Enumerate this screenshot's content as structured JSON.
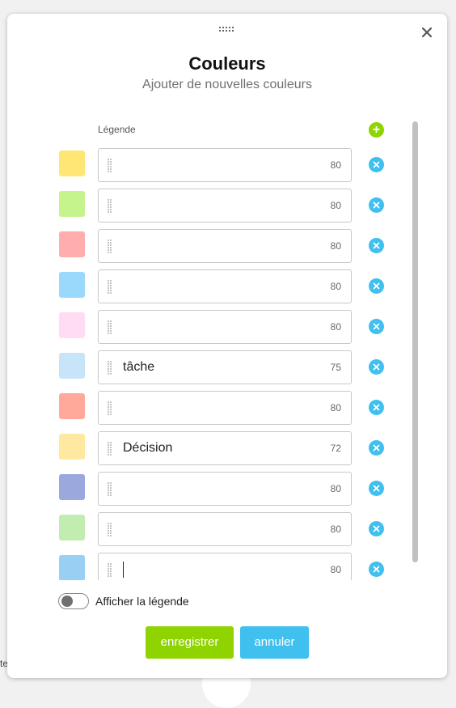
{
  "dialog": {
    "title": "Couleurs",
    "subtitle": "Ajouter de nouvelles couleurs",
    "legend_header": "Légende",
    "add_icon": "plus-icon",
    "close_icon": "close-icon",
    "rows": [
      {
        "color": "#ffe675",
        "text": "",
        "count": "80"
      },
      {
        "color": "#c6f48c",
        "text": "",
        "count": "80"
      },
      {
        "color": "#ffadad",
        "text": "",
        "count": "80"
      },
      {
        "color": "#9ad9fb",
        "text": "",
        "count": "80"
      },
      {
        "color": "#ffdcf4",
        "text": "",
        "count": "80"
      },
      {
        "color": "#c7e4f8",
        "text": "tâche",
        "count": "75"
      },
      {
        "color": "#ffa99a",
        "text": "",
        "count": "80"
      },
      {
        "color": "#ffe89f",
        "text": "Décision",
        "count": "72"
      },
      {
        "color": "#9aa8dd",
        "text": "",
        "count": "80"
      },
      {
        "color": "#c1eeb0",
        "text": "",
        "count": "80"
      },
      {
        "color": "#98cff2",
        "text": "",
        "count": "80",
        "focused": true
      }
    ],
    "show_legend_label": "Afficher la légende",
    "show_legend_on": false,
    "save_label": "enregistrer",
    "cancel_label": "annuler"
  },
  "background": {
    "peek_text": "te"
  },
  "colors": {
    "accent_green": "#8fd400",
    "accent_blue": "#3fc0ef"
  }
}
